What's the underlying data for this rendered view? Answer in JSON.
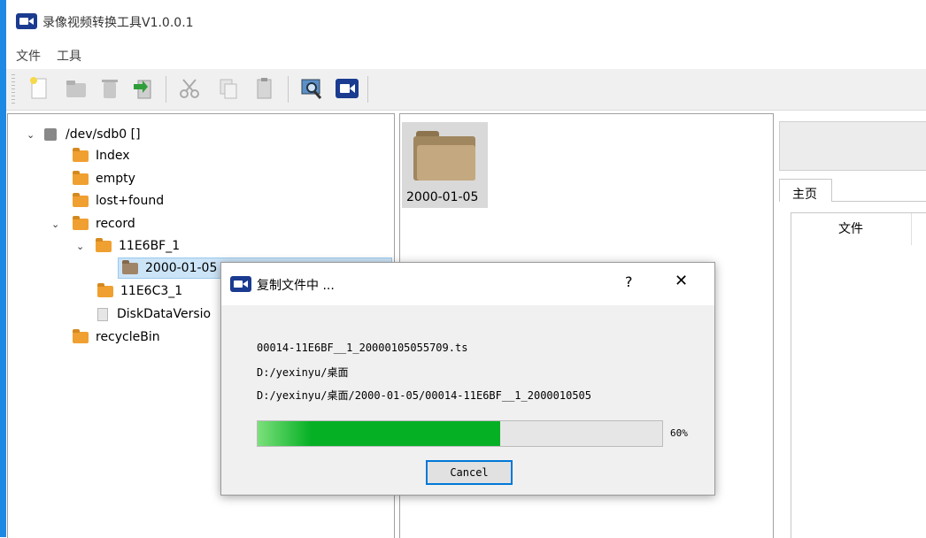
{
  "app": {
    "title": "录像视频转换工具V1.0.0.1"
  },
  "menu": {
    "items": [
      "文件",
      "工具"
    ]
  },
  "toolbar": {
    "buttons": [
      "new-icon",
      "open-folder-icon",
      "delete-icon",
      "export-icon",
      "cut-icon",
      "copy-icon",
      "paste-icon",
      "search-icon",
      "video-camera-icon"
    ]
  },
  "tree": {
    "root": "/dev/sdb0 []",
    "items": [
      "Index",
      "empty",
      "lost+found",
      "record",
      "11E6BF_1",
      "2000-01-05",
      "11E6C3_1",
      "DiskDataVersio",
      "recycleBin"
    ]
  },
  "content": {
    "folder_label": "2000-01-05"
  },
  "right_panel": {
    "tab_label": "主页",
    "column_header": "文件"
  },
  "dialog": {
    "title": "复制文件中 ...",
    "help": "?",
    "close": "✕",
    "file_name": "00014-11E6BF__1_20000105055709.ts",
    "dest_dir": "D:/yexinyu/桌面",
    "dest_path": "D:/yexinyu/桌面/2000-01-05/00014-11E6BF__1_2000010505",
    "progress_value": 60,
    "progress_text": "60%",
    "cancel_label": "Cancel"
  },
  "colors": {
    "accent": "#1e88e5",
    "progress": "#06b025",
    "icon_blue": "#1a3b8f"
  }
}
